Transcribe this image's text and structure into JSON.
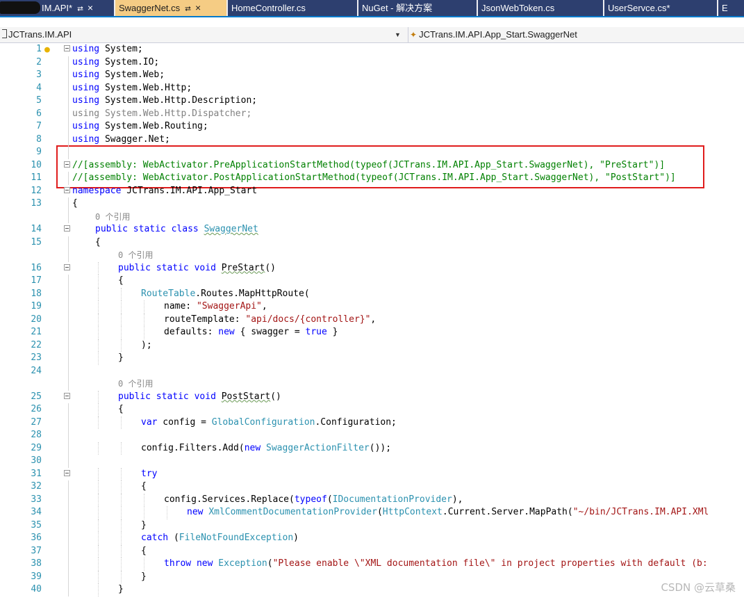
{
  "tabs": [
    {
      "label": "IM.API*",
      "pin": "⮂",
      "close": "×",
      "active": false
    },
    {
      "label": "SwaggerNet.cs",
      "pin": "⮂",
      "close": "×",
      "active": true
    },
    {
      "label": "HomeController.cs",
      "active": false
    },
    {
      "label": "NuGet - 解决方案",
      "active": false
    },
    {
      "label": "JsonWebToken.cs",
      "active": false
    },
    {
      "label": "UserServce.cs*",
      "active": false
    },
    {
      "label": "E",
      "active": false
    }
  ],
  "navbar": {
    "project": "JCTrans.IM.API",
    "dropdown_arrow": "▼",
    "class_path": "JCTrans.IM.API.App_Start.SwaggerNet"
  },
  "code_lens": "0 个引用",
  "lines": [
    {
      "num": "1",
      "text": "using System;"
    },
    {
      "num": "2",
      "text": "using System.IO;"
    },
    {
      "num": "3",
      "text": "using System.Web;"
    },
    {
      "num": "4",
      "text": "using System.Web.Http;"
    },
    {
      "num": "5",
      "text": "using System.Web.Http.Description;"
    },
    {
      "num": "6",
      "text": "using System.Web.Http.Dispatcher;"
    },
    {
      "num": "7",
      "text": "using System.Web.Routing;"
    },
    {
      "num": "8",
      "text": "using Swagger.Net;"
    },
    {
      "num": "9",
      "text": ""
    },
    {
      "num": "10",
      "text": "//[assembly: WebActivator.PreApplicationStartMethod(typeof(JCTrans.IM.API.App_Start.SwaggerNet), \"PreStart\")]"
    },
    {
      "num": "11",
      "text": "//[assembly: WebActivator.PostApplicationStartMethod(typeof(JCTrans.IM.API.App_Start.SwaggerNet), \"PostStart\")]"
    },
    {
      "num": "12",
      "text": "namespace JCTrans.IM.API.App_Start"
    },
    {
      "num": "13",
      "text": "{"
    },
    {
      "num": "14",
      "text": "public static class SwaggerNet"
    },
    {
      "num": "15",
      "text": "{"
    },
    {
      "num": "16",
      "text": "public static void PreStart()"
    },
    {
      "num": "17",
      "text": "{"
    },
    {
      "num": "18",
      "text": "RouteTable.Routes.MapHttpRoute("
    },
    {
      "num": "19",
      "text": "name: \"SwaggerApi\","
    },
    {
      "num": "20",
      "text": "routeTemplate: \"api/docs/{controller}\","
    },
    {
      "num": "21",
      "text": "defaults: new { swagger = true }"
    },
    {
      "num": "22",
      "text": ");"
    },
    {
      "num": "23",
      "text": "}"
    },
    {
      "num": "24",
      "text": ""
    },
    {
      "num": "25",
      "text": "public static void PostStart()"
    },
    {
      "num": "26",
      "text": "{"
    },
    {
      "num": "27",
      "text": "var config = GlobalConfiguration.Configuration;"
    },
    {
      "num": "28",
      "text": ""
    },
    {
      "num": "29",
      "text": "config.Filters.Add(new SwaggerActionFilter());"
    },
    {
      "num": "30",
      "text": ""
    },
    {
      "num": "31",
      "text": "try"
    },
    {
      "num": "32",
      "text": "{"
    },
    {
      "num": "33",
      "text": "config.Services.Replace(typeof(IDocumentationProvider),"
    },
    {
      "num": "34",
      "text": "new XmlCommentDocumentationProvider(HttpContext.Current.Server.MapPath(\"~/bin/JCTrans.IM.API.XMl"
    },
    {
      "num": "35",
      "text": "}"
    },
    {
      "num": "36",
      "text": "catch (FileNotFoundException)"
    },
    {
      "num": "37",
      "text": "{"
    },
    {
      "num": "38",
      "text": "throw new Exception(\"Please enable \\\"XML documentation file\\\" in project properties with default (b:"
    },
    {
      "num": "39",
      "text": "}"
    },
    {
      "num": "40",
      "text": "}"
    }
  ],
  "watermark": "CSDN @云草桑",
  "colors": {
    "keyword": "#0000ff",
    "type": "#2b91af",
    "string": "#a31515",
    "comment": "#008000",
    "line_number": "#2b91af",
    "highlight_box": "#e01c1c",
    "active_tab": "#f5cc84",
    "inactive_tab": "#2d3f6f"
  }
}
